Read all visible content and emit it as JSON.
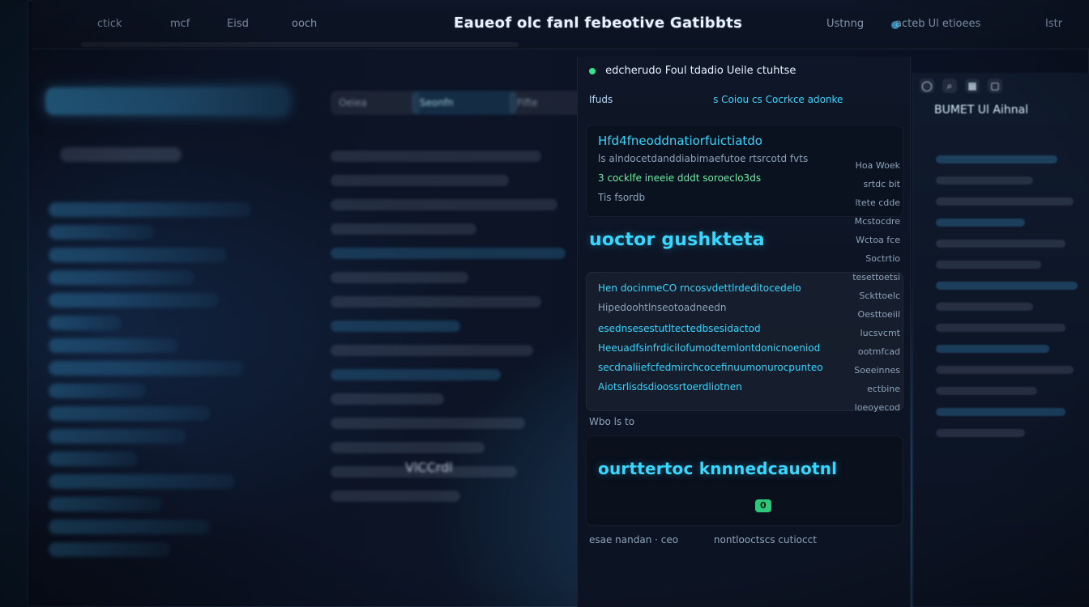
{
  "top_bar": {
    "title": "Eaueof olc fanl febeotive Gatibbts",
    "left_items": [
      "ctick",
      "mcf",
      "Eisd",
      "ooch"
    ],
    "right_items": [
      "Ustnng",
      "acteb Ul etioees",
      "Istr"
    ],
    "right_icons": [
      "user-icon",
      "search-icon",
      "grid-icon",
      "window-icon"
    ]
  },
  "sidebar": {
    "items": [
      "",
      "",
      "",
      "",
      "",
      "",
      "",
      "",
      "",
      "",
      "",
      "",
      "",
      "",
      "",
      ""
    ]
  },
  "middle": {
    "tabs": [
      "Oeiea",
      "Seonfn",
      "Fifte"
    ],
    "rows": [
      "",
      "",
      "",
      "",
      "",
      "",
      "",
      "",
      "",
      "",
      "",
      "",
      "",
      "",
      ""
    ],
    "footer": "VlCCrdl"
  },
  "main": {
    "header": "edcherudo Foul tdadio Ueile ctuhtse",
    "subheader_left": "Ifuds",
    "subheader_right": "s Coiou cs Cocrkce adonke",
    "section_1_title": "Hfd4fneoddnatiorfuictiatdo",
    "section_1_line": "ls alndocetdanddiabimaefutoe rtsrcotd fvts",
    "section_1_line_2": "3 cocklfe ineeie dddt soroeclo3ds",
    "section_1_line_3": "Tis fsordb",
    "big_1": "uoctor gushkteta",
    "section_2_line": "Hen docinmeCO rncosvdettlrdeditocedelo",
    "section_2_sub": "Hipedoohtlnseotoadneedn",
    "list_lines": [
      "esednsesestutltectedbsesidactod",
      "Heeuadfsinfrdicilofumodtemlontdonicnoeniod",
      "secdnaliiefcfedmirchcocefinuumonurocpunteo",
      "Aiotsrlisdsdioossrtoerdliotnen"
    ],
    "small_label": "Wbo ls to",
    "big_2": "ourttertoc knnnedcauotnl",
    "chip": "0",
    "footer_left": "esae nandan  ·  ceo",
    "footer_right": "nontlooctscs cutiocct",
    "ticks": [
      "Hoa Woek",
      "srtdc bit",
      "ltete cdde",
      "Mcstocdre",
      "Wctoa fce",
      "Soctrtio",
      "tesettoetsi",
      "Sckttoelc",
      "Oesttoeiil",
      "lucsvcmt",
      "ootmfcad",
      "Soeeinnes",
      "ectbine",
      "loeoyecod"
    ]
  },
  "right_panel": {
    "title": "BUMET Ul Aihnal",
    "rows": [
      "",
      "",
      "",
      "",
      "",
      "",
      "",
      "",
      "",
      "",
      "",
      "",
      "",
      ""
    ]
  },
  "colors": {
    "background": "#0b1220",
    "accent_cyan": "#39d7ff",
    "accent_green": "#2ec87a"
  }
}
